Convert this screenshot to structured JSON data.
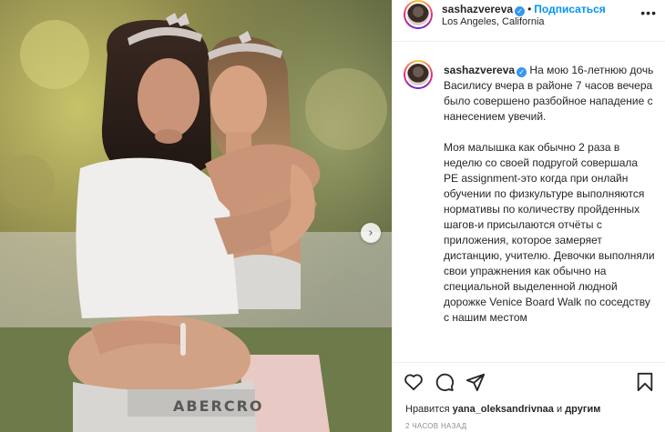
{
  "header": {
    "username": "sashazvereva",
    "dot": "•",
    "follow_label": "Подписаться",
    "location": "Los Angeles, California",
    "more_icon": "more-horizontal-icon"
  },
  "caption": {
    "username": "sashazvereva",
    "paragraphs": [
      "На мою 16-летнюю дочь Василису вчера в районе 7 часов вечера было совершено разбойное нападение с нанесением увечий.",
      "Моя малышка как обычно 2 раза в неделю со своей подругой совершала PE assignment-это когда при онлайн обучении по физкультуре выполняются нормативы по количеству пройденных шагов-и присылаются отчёты с приложения, которое замеряет дистанцию, учителю. Девочки выполняли свои упражнения как обычно на специальной выделенной людной дорожке Venice Board Walk по соседству с нашим местом"
    ]
  },
  "actions": {
    "like_icon": "heart-icon",
    "comment_icon": "comment-icon",
    "share_icon": "share-icon",
    "save_icon": "bookmark-icon"
  },
  "likes": {
    "prefix": "Нравится",
    "user": "yana_oleksandrivnaa",
    "and": "и",
    "others": "другим"
  },
  "timestamp": "2 ЧАСОВ НАЗАД",
  "media": {
    "carousel_next_icon": "chevron-right-icon",
    "shirt_text": "ABERCRO"
  },
  "colors": {
    "accent": "#0095f6",
    "verified": "#3897f0",
    "muted": "#8e8e8e"
  }
}
